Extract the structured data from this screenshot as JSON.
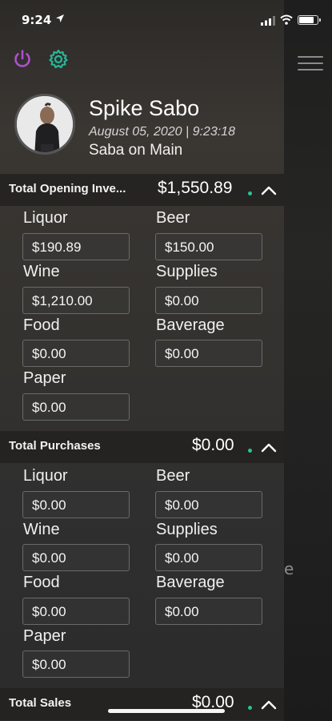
{
  "status_bar": {
    "time": "9:24"
  },
  "user": {
    "name": "Spike Sabo",
    "datetime": "August 05, 2020 | 9:23:18",
    "location": "Saba on Main"
  },
  "icons": {
    "power": "power-icon",
    "settings": "gear-icon",
    "menu": "hamburger-icon"
  },
  "colors": {
    "power": "#b04fcf",
    "settings": "#25b89a",
    "dot": "#2bc19a"
  },
  "sections": [
    {
      "title": "Total Opening Inve...",
      "total": "$1,550.89",
      "fields": [
        {
          "label": "Liquor",
          "value": "$190.89"
        },
        {
          "label": "Beer",
          "value": "$150.00"
        },
        {
          "label": "Wine",
          "value": "$1,210.00"
        },
        {
          "label": "Supplies",
          "value": "$0.00"
        },
        {
          "label": "Food",
          "value": "$0.00"
        },
        {
          "label": "Baverage",
          "value": "$0.00"
        },
        {
          "label": "Paper",
          "value": "$0.00"
        }
      ]
    },
    {
      "title": "Total Purchases",
      "total": "$0.00",
      "fields": [
        {
          "label": "Liquor",
          "value": "$0.00"
        },
        {
          "label": "Beer",
          "value": "$0.00"
        },
        {
          "label": "Wine",
          "value": "$0.00"
        },
        {
          "label": "Supplies",
          "value": "$0.00"
        },
        {
          "label": "Food",
          "value": "$0.00"
        },
        {
          "label": "Baverage",
          "value": "$0.00"
        },
        {
          "label": "Paper",
          "value": "$0.00"
        }
      ]
    },
    {
      "title": "Total Sales",
      "total": "$0.00",
      "fields": []
    }
  ],
  "background_text": "e"
}
